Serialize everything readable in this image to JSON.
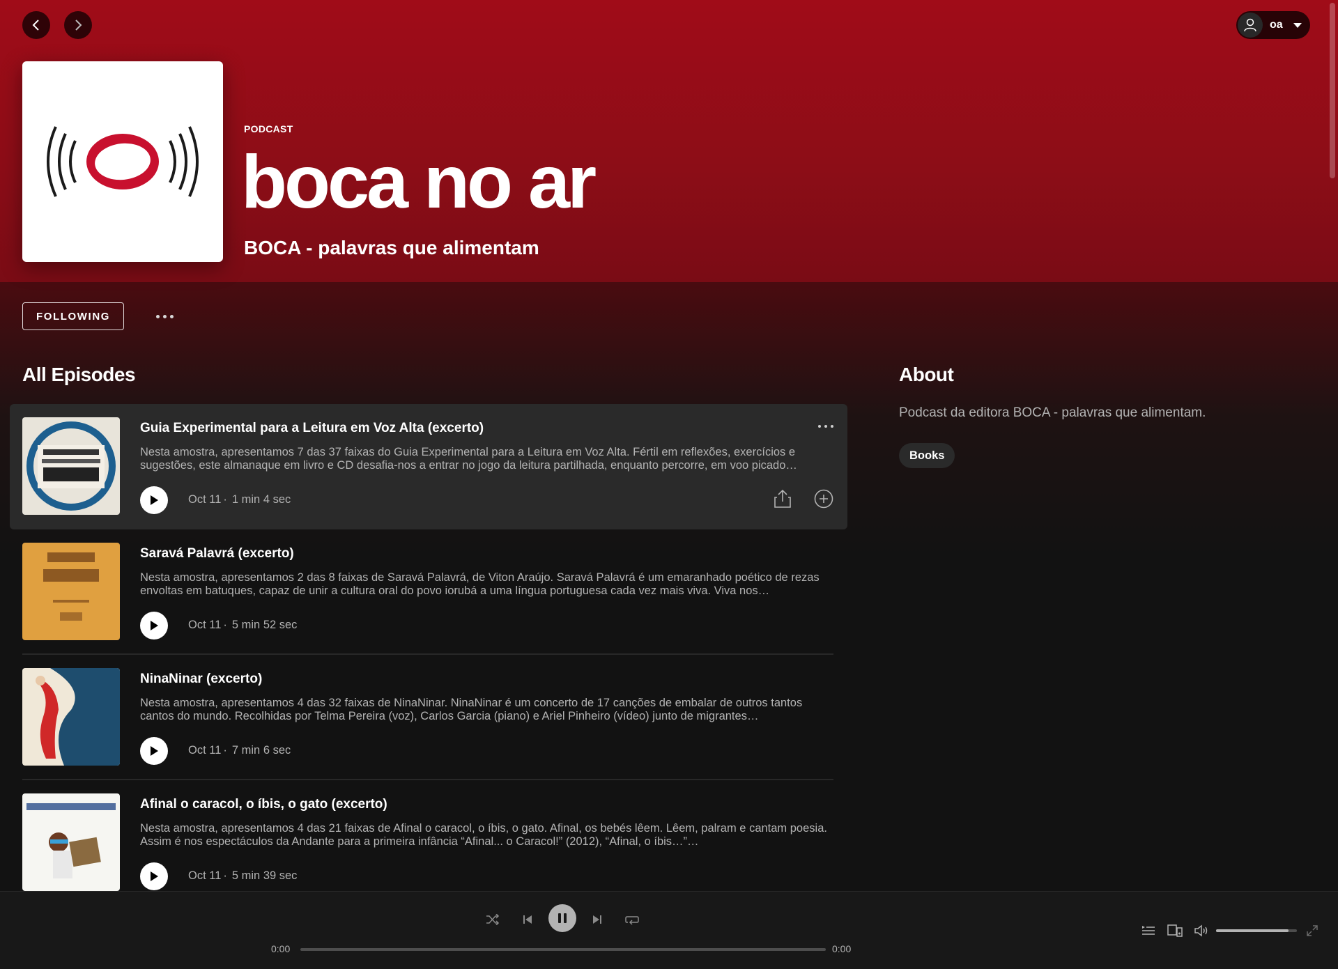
{
  "nav": {
    "back_label": "Back",
    "forward_label": "Forward"
  },
  "user": {
    "name": "oa"
  },
  "podcast": {
    "type_label": "PODCAST",
    "title": "boca no ar",
    "publisher": "BOCA - palavras que alimentam"
  },
  "actions": {
    "follow_label": "FOLLOWING"
  },
  "episodes_section": {
    "title": "All Episodes"
  },
  "episodes": [
    {
      "title": "Guia Experimental para a Leitura em Voz Alta (excerto)",
      "description": "Nesta amostra, apresentamos 7 das 37 faixas do Guia Experimental para a Leitura em Voz Alta. Fértil em reflexões, exercícios e sugestões, este almanaque em livro e CD desafia-nos a entrar no jogo da leitura partilhada, enquanto percorre, em voo picado…",
      "date": "Oct 11",
      "duration": "1 min 4 sec",
      "active": true
    },
    {
      "title": "Saravá Palavrá (excerto)",
      "description": "Nesta amostra, apresentamos 2 das 8 faixas de Saravá Palavrá, de Viton Araújo. Saravá Palavrá é um emaranhado poético de rezas envoltas em batuques, capaz de unir a cultura oral do povo iorubá a uma língua portuguesa cada vez mais viva. Viva nos…",
      "date": "Oct 11",
      "duration": "5 min 52 sec",
      "active": false
    },
    {
      "title": "NinaNinar (excerto)",
      "description": "Nesta amostra, apresentamos 4 das 32 faixas de NinaNinar. NinaNinar é um concerto de 17 canções de embalar de outros tantos cantos do mundo. Recolhidas por Telma Pereira (voz), Carlos Garcia (piano) e Ariel Pinheiro (vídeo) junto de migrantes…",
      "date": "Oct 11",
      "duration": "7 min 6 sec",
      "active": false
    },
    {
      "title": "Afinal o caracol, o íbis, o gato (excerto)",
      "description": "Nesta amostra, apresentamos 4 das 21 faixas de Afinal o caracol, o íbis, o gato. Afinal, os bebés lêem. Lêem, palram e cantam poesia. Assim é nos espectáculos da Andante para a primeira infância “Afinal... o Caracol!” (2012), “Afinal, o íbis…”…",
      "date": "Oct 11",
      "duration": "5 min 39 sec",
      "active": false
    }
  ],
  "about": {
    "title": "About",
    "text": "Podcast da editora BOCA - palavras que alimentam.",
    "tag": "Books"
  },
  "player": {
    "elapsed": "0:00",
    "total": "0:00",
    "progress": 0,
    "volume": 0.9
  },
  "colors": {
    "accent": "#a00c18",
    "background": "#121212",
    "player_background": "#181818",
    "secondary_text": "#b3b3b3"
  },
  "icons": {
    "back": "chevron-left-icon",
    "forward": "chevron-right-icon",
    "user": "user-icon",
    "more": "ellipsis-icon",
    "play": "play-icon",
    "share": "share-icon",
    "add": "add-circle-icon",
    "shuffle": "shuffle-icon",
    "previous": "previous-icon",
    "pause": "pause-icon",
    "next": "next-icon",
    "repeat": "repeat-icon",
    "queue": "queue-icon",
    "devices": "devices-icon",
    "volume": "volume-icon",
    "fullscreen": "fullscreen-icon"
  }
}
